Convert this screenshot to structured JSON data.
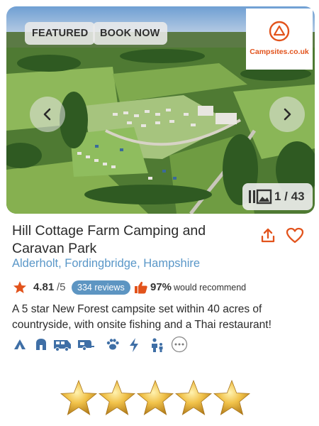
{
  "listing": {
    "badge_featured": "FEATURED",
    "book_now_label": "BOOK NOW",
    "logo_text": "Campsites.co.uk",
    "photo_counter": "1 / 43",
    "title": "Hill Cottage Farm Camping and Caravan Park",
    "location": "Alderholt, Fordingbridge, Hampshire",
    "rating": {
      "score": "4.81",
      "out_of": "/5",
      "reviews_label": "334 reviews",
      "recommend_percent": "97%",
      "recommend_label": "would recommend"
    },
    "description": "A 5 star New Forest campsite set within 40 acres of countryside, with onsite fishing and a Thai restaurant!",
    "amenities": [
      "tent-icon",
      "glamping-pod-icon",
      "motorhome-icon",
      "caravan-icon",
      "pet-paw-icon",
      "electric-hookup-icon",
      "family-icon",
      "more-icon"
    ],
    "star_rating": 5
  },
  "colors": {
    "accent_orange": "#e2531c",
    "link_blue": "#5a97c8",
    "badge_blue": "#5d95c2",
    "icon_blue": "#3f6fa6",
    "gold_star": "#e0a82e"
  }
}
